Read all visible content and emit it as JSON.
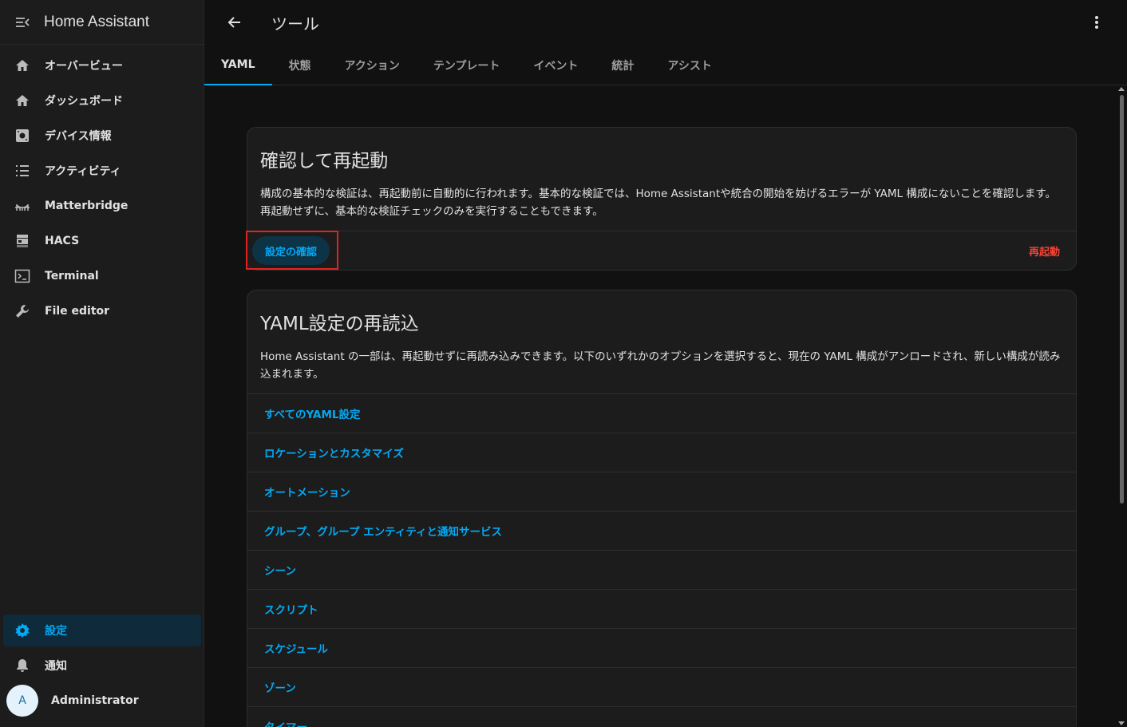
{
  "app": {
    "title": "Home Assistant"
  },
  "sidebar": {
    "items": [
      {
        "label": "オーバービュー",
        "icon": "home-icon"
      },
      {
        "label": "ダッシュボード",
        "icon": "home-icon"
      },
      {
        "label": "デバイス情報",
        "icon": "device-icon"
      },
      {
        "label": "アクティビティ",
        "icon": "list-icon"
      },
      {
        "label": "Matterbridge",
        "icon": "bridge-icon"
      },
      {
        "label": "HACS",
        "icon": "hacs-icon"
      },
      {
        "label": "Terminal",
        "icon": "terminal-icon"
      },
      {
        "label": "File editor",
        "icon": "wrench-icon"
      }
    ],
    "settings_label": "設定",
    "notifications_label": "通知",
    "user": {
      "initial": "A",
      "name": "Administrator"
    }
  },
  "header": {
    "title": "ツール"
  },
  "tabs": [
    {
      "label": "YAML",
      "active": true
    },
    {
      "label": "状態"
    },
    {
      "label": "アクション"
    },
    {
      "label": "テンプレート"
    },
    {
      "label": "イベント"
    },
    {
      "label": "統計"
    },
    {
      "label": "アシスト"
    }
  ],
  "check_card": {
    "title": "確認して再起動",
    "description": "構成の基本的な検証は、再起動前に自動的に行われます。基本的な検証では、Home Assistantや統合の開始を妨げるエラーが YAML 構成にないことを確認します。再起動せずに、基本的な検証チェックのみを実行することもできます。",
    "check_button": "設定の確認",
    "restart_button": "再起動"
  },
  "reload_card": {
    "title": "YAML設定の再読込",
    "description": "Home Assistant の一部は、再起動せずに再読み込みできます。以下のいずれかのオプションを選択すると、現在の YAML 構成がアンロードされ、新しい構成が読み込まれます。",
    "items": [
      "すべてのYAML設定",
      "ロケーションとカスタマイズ",
      "オートメーション",
      "グループ、グループ エンティティと通知サービス",
      "シーン",
      "スクリプト",
      "スケジュール",
      "ゾーン",
      "タイマー"
    ]
  },
  "colors": {
    "accent": "#03a9f4",
    "danger": "#f44336",
    "highlight": "#e02424"
  }
}
